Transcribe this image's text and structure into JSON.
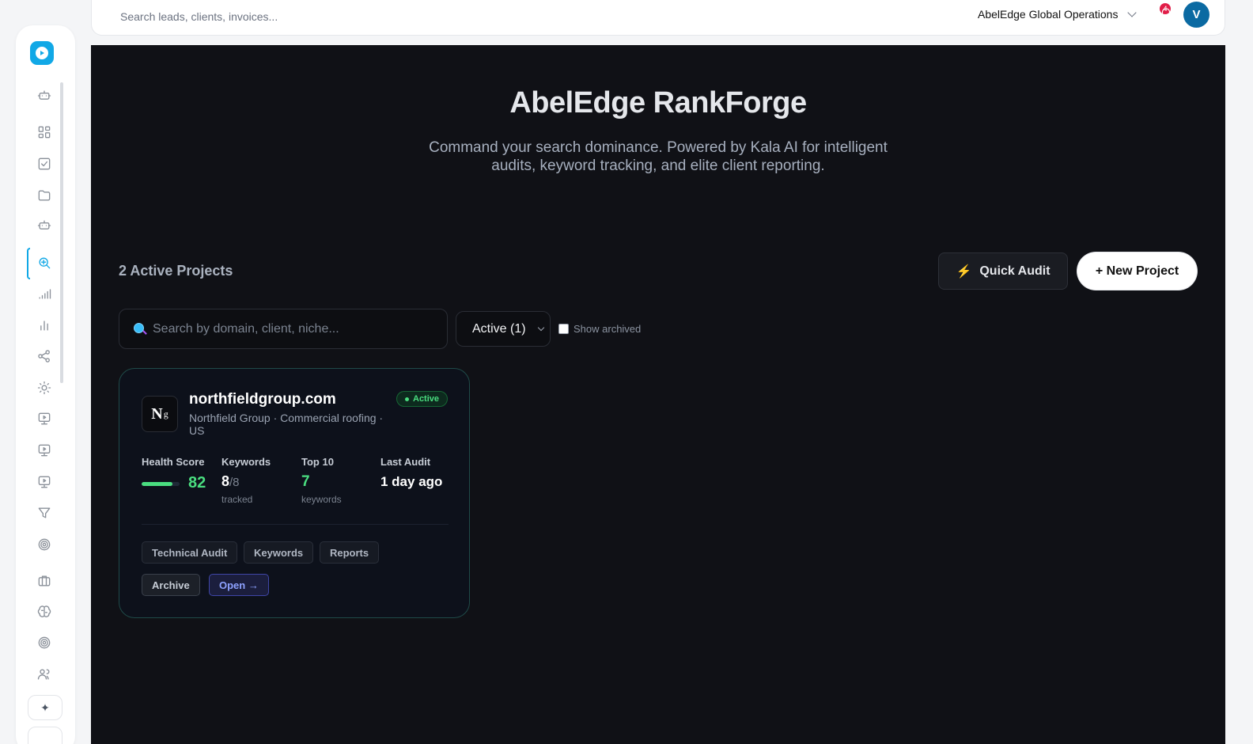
{
  "topbar": {
    "search_placeholder": "Search leads, clients, invoices...",
    "org_name": "AbelEdge Global Operations",
    "notification_count": "4",
    "avatar_initial": "V"
  },
  "hero": {
    "title": "AbelEdge RankForge",
    "subtitle": "Command your search dominance. Powered by Kala AI for intelligent audits, keyword tracking, and elite client reporting."
  },
  "toolbar": {
    "projects_count": "2 Active Projects",
    "quick_audit_label": "Quick Audit",
    "new_project_label": "+ New Project",
    "search_placeholder": "Search by domain, client, niche...",
    "filter_selected": "Active (1)",
    "show_archived_label": "Show archived"
  },
  "project": {
    "logo_text": "N",
    "logo_sup": "g",
    "domain": "northfieldgroup.com",
    "meta": "Northfield Group · Commercial roofing · US",
    "status": "Active",
    "health_label": "Health Score",
    "health_score": "82",
    "health_fraction": 0.82,
    "keywords_label": "Keywords",
    "keywords_tracked": "8",
    "keywords_total": "/8",
    "keywords_sub": "tracked",
    "top10_label": "Top 10",
    "top10_value": "7",
    "top10_sub": "keywords",
    "last_audit_label": "Last Audit",
    "last_audit_value": "1 day ago",
    "actions": {
      "technical_audit": "Technical Audit",
      "keywords": "Keywords",
      "reports": "Reports",
      "archive": "Archive",
      "open": "Open →"
    }
  },
  "colors": {
    "accent": "#11a8e6",
    "success": "#4ade80",
    "panel_bg": "#101116",
    "open_accent": "#8ea2ff"
  },
  "sidebar_icons": [
    "logo-icon",
    "robot-icon",
    "grid-icon",
    "checkbox-icon",
    "folder-icon",
    "robot-icon",
    "search-zoom-icon",
    "signal-icon",
    "bar-chart-icon",
    "share-icon",
    "sun-icon",
    "monitor-play-icon",
    "monitor-play-icon",
    "monitor-play-icon",
    "filter-icon",
    "target-icon",
    "briefcase-icon",
    "brain-icon",
    "target-icon",
    "users-icon",
    "sparkle-icon"
  ]
}
